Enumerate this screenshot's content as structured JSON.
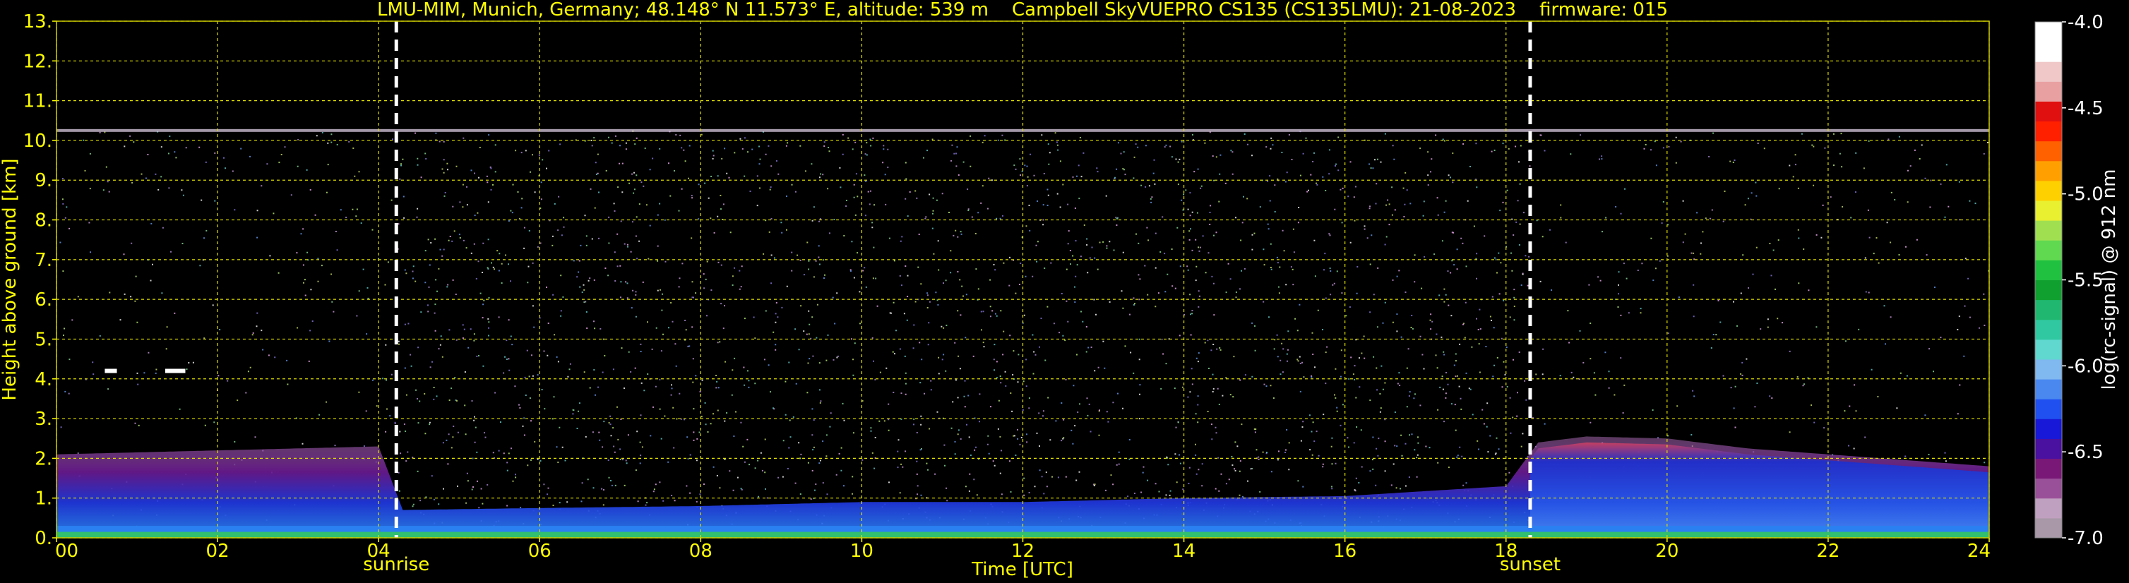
{
  "chart_data": {
    "type": "heatmap",
    "title": "LMU-MIM, Munich, Germany; 48.148° N 11.573° E, altitude: 539 m    Campbell SkyVUEPRO CS135 (CS135LMU): 21-08-2023    firmware: 015",
    "xlabel": "Time [UTC]",
    "ylabel": "Height above ground [km]",
    "colorbar_label": "log(rc-signal) @ 912 nm",
    "xlim": [
      0,
      24
    ],
    "ylim": [
      0,
      13
    ],
    "x_ticks": [
      0,
      2,
      4,
      6,
      8,
      10,
      12,
      14,
      16,
      18,
      20,
      22,
      24
    ],
    "x_tick_labels": [
      "00",
      "02",
      "04",
      "06",
      "08",
      "10",
      "12",
      "14",
      "16",
      "18",
      "20",
      "22",
      "24"
    ],
    "y_ticks": [
      0,
      1,
      2,
      3,
      4,
      5,
      6,
      7,
      8,
      9,
      10,
      11,
      12,
      13
    ],
    "y_tick_labels": [
      "0.",
      "1.",
      "2.",
      "3.",
      "4.",
      "5.",
      "6.",
      "7.",
      "8.",
      "9.",
      "10.",
      "11.",
      "12.",
      "13."
    ],
    "grid": true,
    "colorbar": {
      "range": [
        -7.0,
        -4.0
      ],
      "ticks": [
        -4.0,
        -4.5,
        -5.0,
        -5.5,
        -6.0,
        -6.5,
        -7.0
      ],
      "tick_labels": [
        "-4.0",
        "-4.5",
        "-5.0",
        "-5.5",
        "-6.0",
        "-6.5",
        "-7.0"
      ],
      "colors": [
        "#a898a8",
        "#c0a0c0",
        "#9a5098",
        "#7a1878",
        "#4a10a0",
        "#1818d8",
        "#2050f0",
        "#4a88f0",
        "#80b8f0",
        "#60d8d0",
        "#30c8a0",
        "#20b870",
        "#10a030",
        "#20c040",
        "#60d850",
        "#a0e050",
        "#e8f030",
        "#ffd000",
        "#ffa000",
        "#ff6000",
        "#ff2000",
        "#e01010",
        "#e8a0a0",
        "#f0c8c8",
        "#ffffff",
        "#ffffff"
      ]
    },
    "events": [
      {
        "label": "sunrise",
        "time": 4.22
      },
      {
        "label": "sunset",
        "time": 18.3
      }
    ],
    "max_range_km": 10.25,
    "boundary_layer_top_km": [
      [
        0,
        2.1
      ],
      [
        2,
        2.2
      ],
      [
        4,
        2.3
      ],
      [
        4.3,
        0.7
      ],
      [
        6,
        0.75
      ],
      [
        8,
        0.8
      ],
      [
        10,
        0.9
      ],
      [
        12,
        0.9
      ],
      [
        14,
        1.0
      ],
      [
        16,
        1.05
      ],
      [
        18,
        1.3
      ],
      [
        18.4,
        2.4
      ],
      [
        19,
        2.55
      ],
      [
        20,
        2.5
      ],
      [
        21,
        2.25
      ],
      [
        22,
        2.1
      ],
      [
        23,
        1.95
      ],
      [
        24,
        1.8
      ]
    ],
    "residual_layer_top_km": [
      [
        0,
        1.0
      ],
      [
        4,
        1.0
      ],
      [
        18.3,
        1.0
      ],
      [
        24,
        1.0
      ]
    ],
    "cloud_patches": [
      {
        "time_start": 0.6,
        "time_end": 0.75,
        "height_km": 4.2,
        "level": -4.0
      },
      {
        "time_start": 1.35,
        "time_end": 1.6,
        "height_km": 4.2,
        "level": -4.0
      }
    ],
    "colors": {
      "background": "#000000",
      "text": "#ffff00",
      "grid": "#e0e000",
      "axis": "#ffff00",
      "event_line": "#ffffff",
      "colorbar_text": "#ffffff"
    }
  }
}
